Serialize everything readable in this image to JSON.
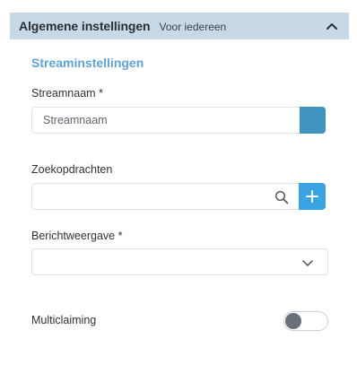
{
  "section": {
    "title": "Algemene instellingen",
    "subtitle": "Voor iedereen",
    "collapse_icon": "chevron-up-icon"
  },
  "form": {
    "heading": "Streaminstellingen",
    "stream_name": {
      "label": "Streamnaam *",
      "value": "Streamnaam",
      "color": "#3f93c0"
    },
    "search_queries": {
      "label": "Zoekopdrachten",
      "value": "",
      "icon": "search-icon",
      "add_icon": "plus-icon"
    },
    "message_view": {
      "label": "Berichtweergave *",
      "value": "",
      "icon": "chevron-down-icon"
    },
    "multiclaiming": {
      "label": "Multiclaiming",
      "enabled": false
    }
  },
  "colors": {
    "header_bg": "#c7d9e6",
    "accent": "#5fa3d6",
    "button": "#3aa3e3"
  }
}
